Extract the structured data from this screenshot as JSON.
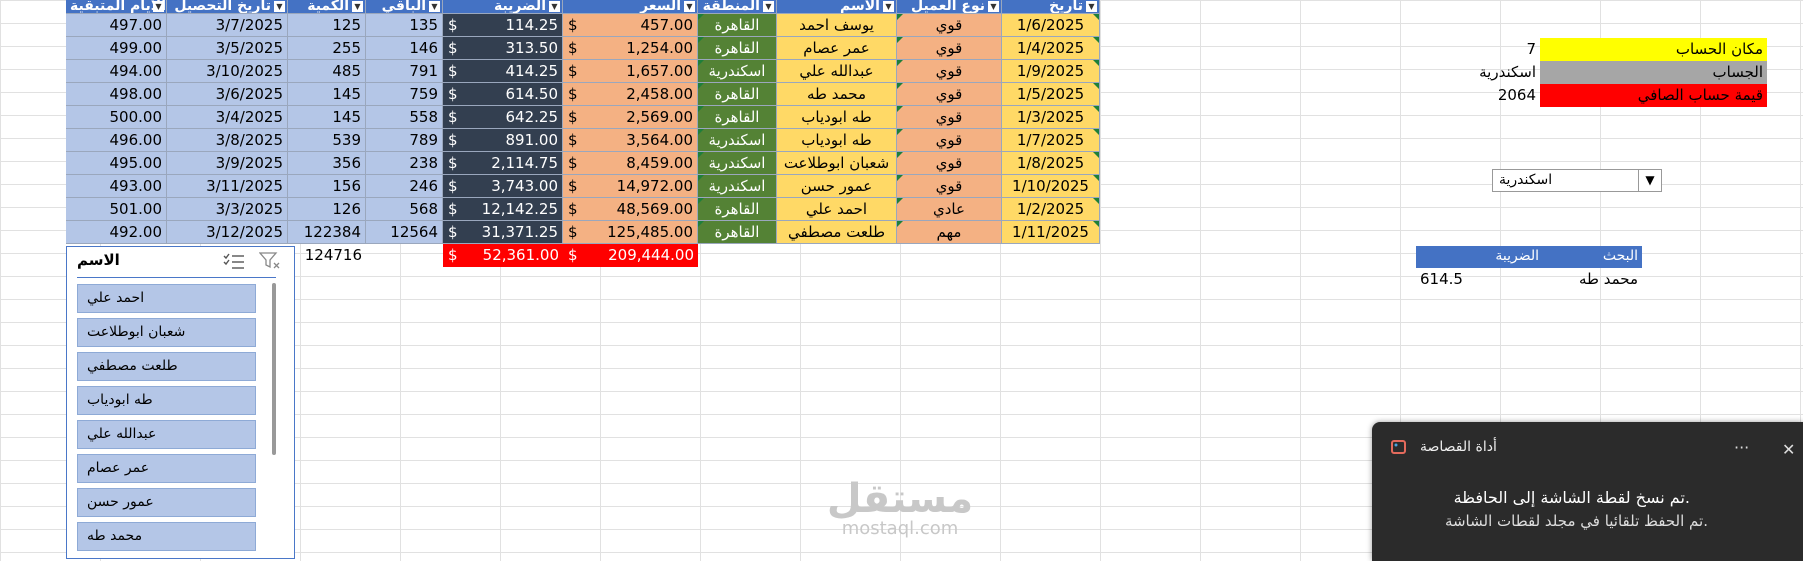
{
  "table": {
    "headers": [
      "تاريخ",
      "نوع العميل",
      "الاسم",
      "المنطقة",
      "السعر",
      "الضريبة",
      "الباقي",
      "الكمية",
      "تاريخ التحصيل",
      "الأيام المتبقية"
    ],
    "currency": "$",
    "rows": [
      [
        "1/6/2025",
        "قوي",
        "يوسف احمد",
        "القاهرة",
        "457.00",
        "114.25",
        "135",
        "125",
        "3/7/2025",
        "497.00"
      ],
      [
        "1/4/2025",
        "قوي",
        "عمر عصام",
        "القاهرة",
        "1,254.00",
        "313.50",
        "146",
        "255",
        "3/5/2025",
        "499.00"
      ],
      [
        "1/9/2025",
        "قوي",
        "عبدالله علي",
        "اسكندرية",
        "1,657.00",
        "414.25",
        "791",
        "485",
        "3/10/2025",
        "494.00"
      ],
      [
        "1/5/2025",
        "قوي",
        "محمد طه",
        "القاهرة",
        "2,458.00",
        "614.50",
        "759",
        "145",
        "3/6/2025",
        "498.00"
      ],
      [
        "1/3/2025",
        "قوي",
        "طه ابودياب",
        "القاهرة",
        "2,569.00",
        "642.25",
        "558",
        "145",
        "3/4/2025",
        "500.00"
      ],
      [
        "1/7/2025",
        "قوي",
        "طه ابودياب",
        "اسكندرية",
        "3,564.00",
        "891.00",
        "789",
        "539",
        "3/8/2025",
        "496.00"
      ],
      [
        "1/8/2025",
        "قوي",
        "شعبان ابوطلاعت",
        "اسكندرية",
        "8,459.00",
        "2,114.75",
        "238",
        "356",
        "3/9/2025",
        "495.00"
      ],
      [
        "1/10/2025",
        "قوي",
        "عمور حسن",
        "اسكندرية",
        "14,972.00",
        "3,743.00",
        "246",
        "156",
        "3/11/2025",
        "493.00"
      ],
      [
        "1/2/2025",
        "عادي",
        "احمد علي",
        "القاهرة",
        "48,569.00",
        "12,142.25",
        "568",
        "126",
        "3/3/2025",
        "501.00"
      ],
      [
        "1/11/2025",
        "مهم",
        "طلعت مصطفي",
        "القاهرة",
        "125,485.00",
        "31,371.25",
        "12564",
        "122384",
        "3/12/2025",
        "492.00"
      ]
    ],
    "totals": {
      "price": "209,444.00",
      "tax": "52,361.00",
      "qty": "124716"
    }
  },
  "slicer": {
    "title": "الاسم",
    "items": [
      "احمد علي",
      "شعبان ابوطلاعت",
      "طلعت مصطفي",
      "طه ابودياب",
      "عبدالله علي",
      "عمر عصام",
      "عمور حسن",
      "محمد طه"
    ]
  },
  "summary": {
    "rows": [
      {
        "label": "مكان الحساب",
        "value": "7",
        "color": "#ffff00"
      },
      {
        "label": "الجساب",
        "value": "اسكندرية",
        "color": "#a6a6a6"
      },
      {
        "label": "قيمة حساب الصافي",
        "value": "2064",
        "color": "#ff0000"
      }
    ]
  },
  "dropdown": {
    "value": "اسكندرية"
  },
  "lookup": {
    "headers": [
      "البحث",
      "الضريبة"
    ],
    "name": "محمد طه",
    "value": "614.5"
  },
  "toast": {
    "app": "أداة القصاصة",
    "line1": "تم نسخ لقطة الشاشة إلى الحافظة.",
    "line2": "تم الحفظ تلقائيا في مجلد لقطات الشاشة.",
    "more": "···",
    "close": "✕"
  },
  "watermark": {
    "ar": "مستقل",
    "en": "mostaql.com"
  },
  "colors": {
    "header": "#4472c4",
    "date": "#ffd966",
    "type": "#f4b183",
    "name": "#ffd966",
    "region": "#548235",
    "price": "#f4b183",
    "tax": "#333f50",
    "rest": "#b4c6e7",
    "total": "#ff0000"
  }
}
